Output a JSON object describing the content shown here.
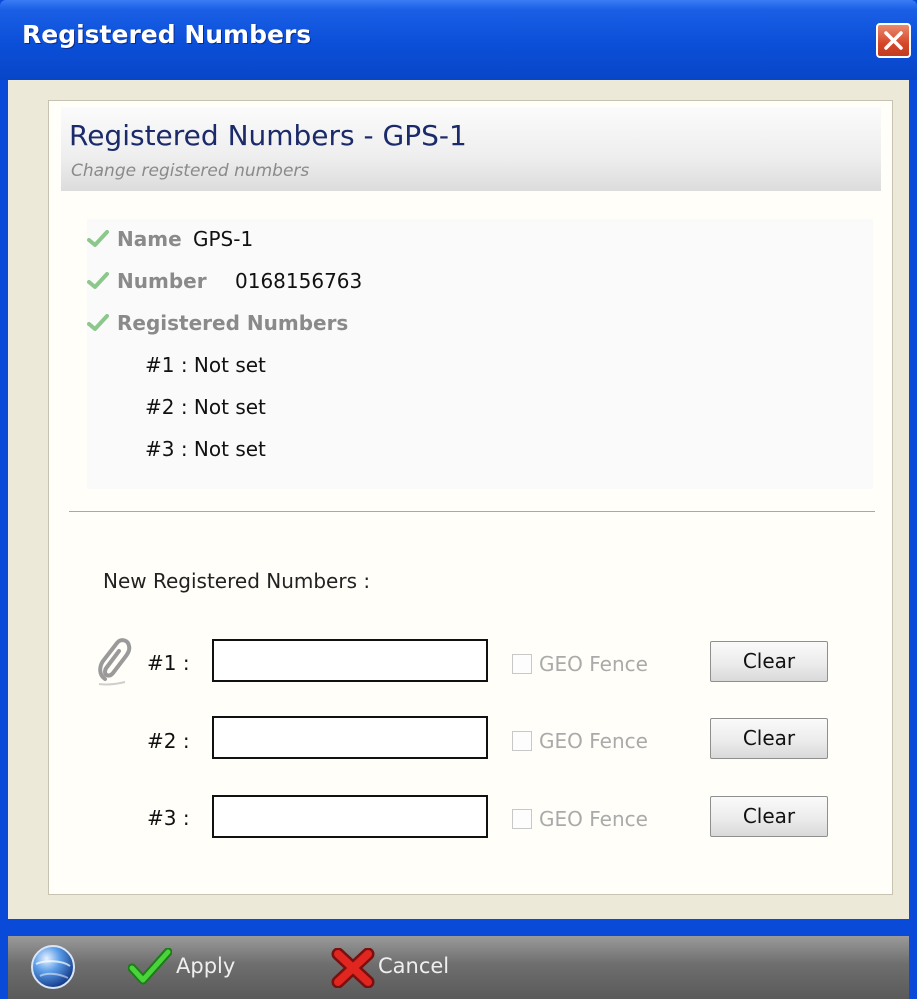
{
  "window": {
    "title": "Registered Numbers",
    "close_icon": "close-icon"
  },
  "header": {
    "title": "Registered Numbers - GPS-1",
    "subtitle": "Change registered numbers"
  },
  "info": {
    "name_label": "Name",
    "name_value": "GPS-1",
    "number_label": "Number",
    "number_value": "0168156763",
    "registered_label": "Registered Numbers",
    "registered": [
      "#1 : Not set",
      "#2 : Not set",
      "#3 : Not set"
    ]
  },
  "form": {
    "new_label": "New Registered Numbers :",
    "slots": [
      {
        "label": "#1 :",
        "value": "",
        "geo_label": "GEO Fence",
        "geo_checked": false,
        "clear_label": "Clear"
      },
      {
        "label": "#2 :",
        "value": "",
        "geo_label": "GEO Fence",
        "geo_checked": false,
        "clear_label": "Clear"
      },
      {
        "label": "#3 :",
        "value": "",
        "geo_label": "GEO Fence",
        "geo_checked": false,
        "clear_label": "Clear"
      }
    ]
  },
  "footer": {
    "apply_label": "Apply",
    "cancel_label": "Cancel"
  },
  "colors": {
    "titlebar": "#0b4fd8",
    "header_title": "#1b2a6a",
    "check": "#7fc07f",
    "footer": "#6e6e6e"
  }
}
